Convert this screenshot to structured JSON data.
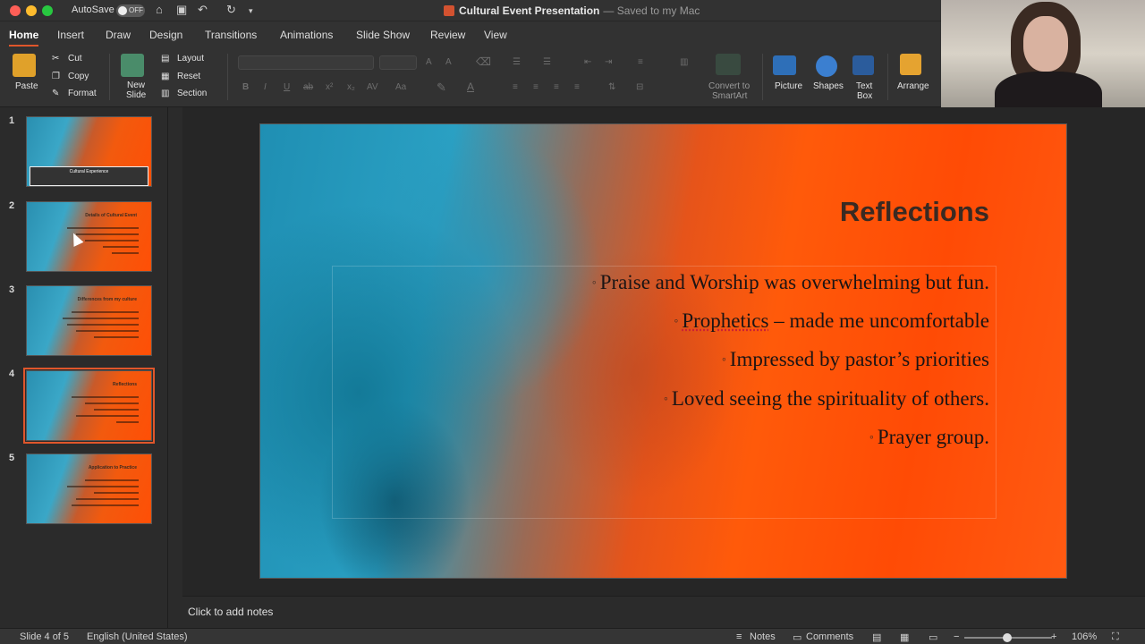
{
  "titlebar": {
    "autosave_label": "AutoSave",
    "autosave_state": "OFF",
    "doc_title": "Cultural Event Presentation",
    "saved_status": "— Saved to my Mac"
  },
  "tabs": [
    "Home",
    "Insert",
    "Draw",
    "Design",
    "Transitions",
    "Animations",
    "Slide Show",
    "Review",
    "View"
  ],
  "ribbon": {
    "paste": "Paste",
    "cut": "Cut",
    "copy": "Copy",
    "format": "Format",
    "new_slide_line1": "New",
    "new_slide_line2": "Slide",
    "layout": "Layout",
    "reset": "Reset",
    "section": "Section",
    "convert_line1": "Convert to",
    "convert_line2": "SmartArt",
    "picture": "Picture",
    "shapes": "Shapes",
    "textbox_line1": "Text",
    "textbox_line2": "Box",
    "arrange": "Arrange"
  },
  "thumbnails": [
    {
      "num": "1",
      "title": "Cultural Experience"
    },
    {
      "num": "2",
      "title": "Details of Cultural Event"
    },
    {
      "num": "3",
      "title": "Differences from my culture"
    },
    {
      "num": "4",
      "title": "Reflections"
    },
    {
      "num": "5",
      "title": "Application to Practice"
    }
  ],
  "slide": {
    "title": "Reflections",
    "bullets": [
      "Praise and Worship was overwhelming but fun.",
      "Prophetics",
      " – made me uncomfortable",
      "Impressed by pastor’s priorities",
      "Loved seeing the spirituality of others.",
      "Prayer group."
    ]
  },
  "notes_placeholder": "Click to add notes",
  "status": {
    "slide_count": "Slide 4 of 5",
    "language": "English (United States)",
    "notes": "Notes",
    "comments": "Comments",
    "zoom": "106%"
  },
  "colors": {
    "accent": "#e0562b",
    "ui_bg": "#2b2b2b",
    "slide_text": "#1a1414"
  }
}
